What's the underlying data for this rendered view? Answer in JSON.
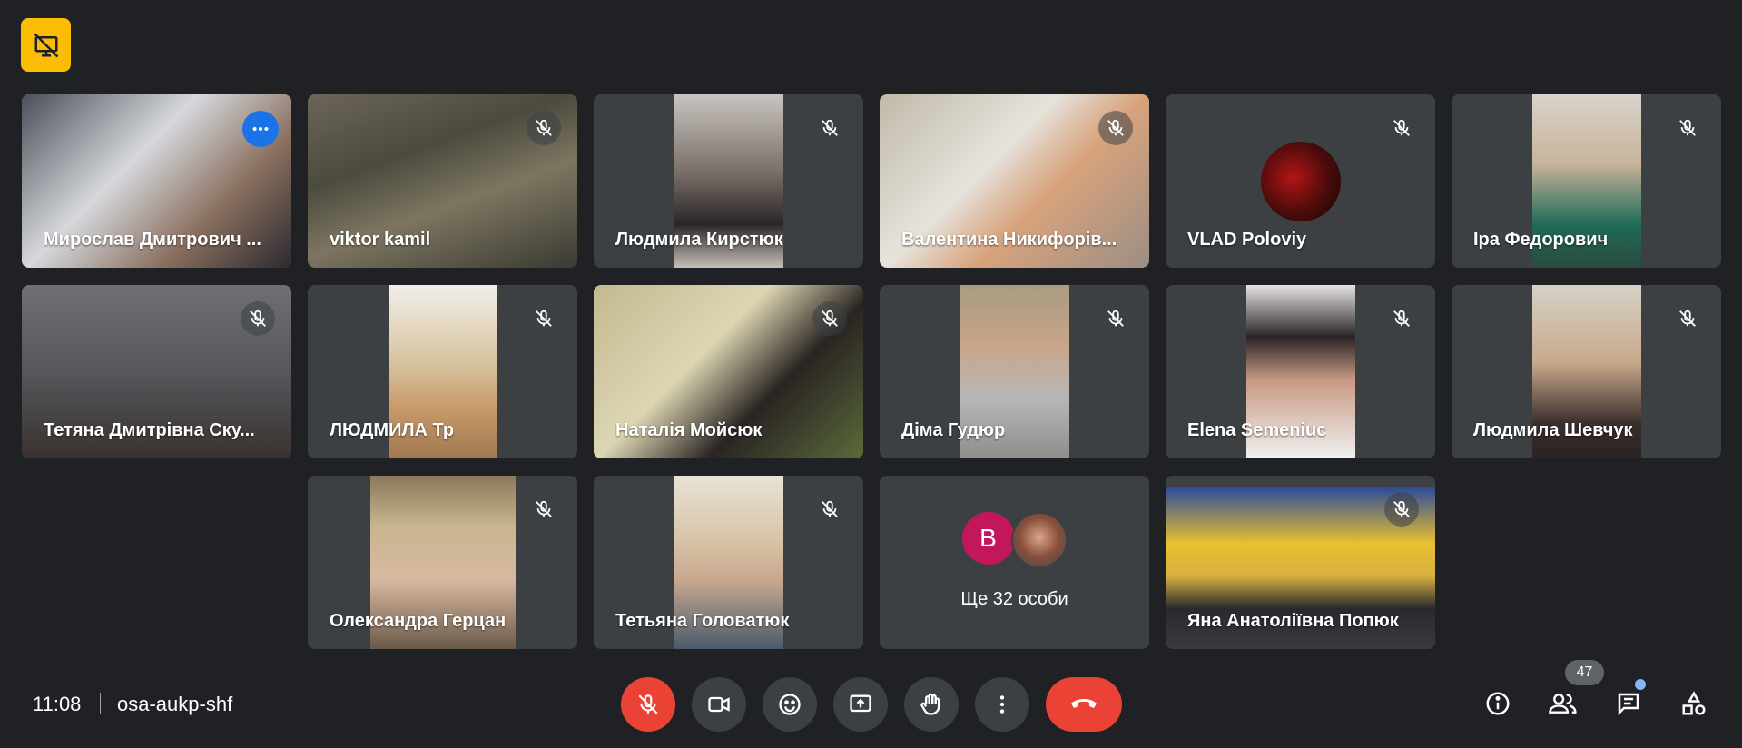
{
  "meeting": {
    "time": "11:08",
    "code": "osa-aukp-shf"
  },
  "participants": [
    {
      "name": "Мирослав Дмитрович ...",
      "active": true
    },
    {
      "name": "viktor kamil"
    },
    {
      "name": "Людмила Кирстюк"
    },
    {
      "name": "Валентина Никифорів..."
    },
    {
      "name": "VLAD Poloviy"
    },
    {
      "name": "Іра Федорович"
    },
    {
      "name": "Тетяна Дмитрівна Ску..."
    },
    {
      "name": "ЛЮДМИЛА Тр"
    },
    {
      "name": "Наталія Мойсюк"
    },
    {
      "name": "Діма Гудюр"
    },
    {
      "name": "Elena Semeniuc"
    },
    {
      "name": "Людмила Шевчук"
    },
    {
      "name": "Олександра Герцан"
    },
    {
      "name": "Тетьяна Головатюк"
    },
    {
      "name": "Яна Анатоліївна Попюк"
    }
  ],
  "others": {
    "avatar_letter": "B",
    "label": "Ще 32 особи"
  },
  "people_count": "47",
  "icons": {
    "top_badge": "presentation-off-icon",
    "mute": "mic-off-icon",
    "more": "more-horiz-icon",
    "controls": [
      "mic-off-icon",
      "camera-icon",
      "emoji-icon",
      "present-screen-icon",
      "raise-hand-icon",
      "more-vert-icon",
      "call-end-icon"
    ],
    "right": [
      "info-icon",
      "people-icon",
      "chat-icon",
      "activities-icon"
    ]
  },
  "colors": {
    "background": "#202124",
    "tile": "#3c4043",
    "accent": "#8ab4f8",
    "danger": "#ea4335",
    "badge": "#fbbc04"
  }
}
